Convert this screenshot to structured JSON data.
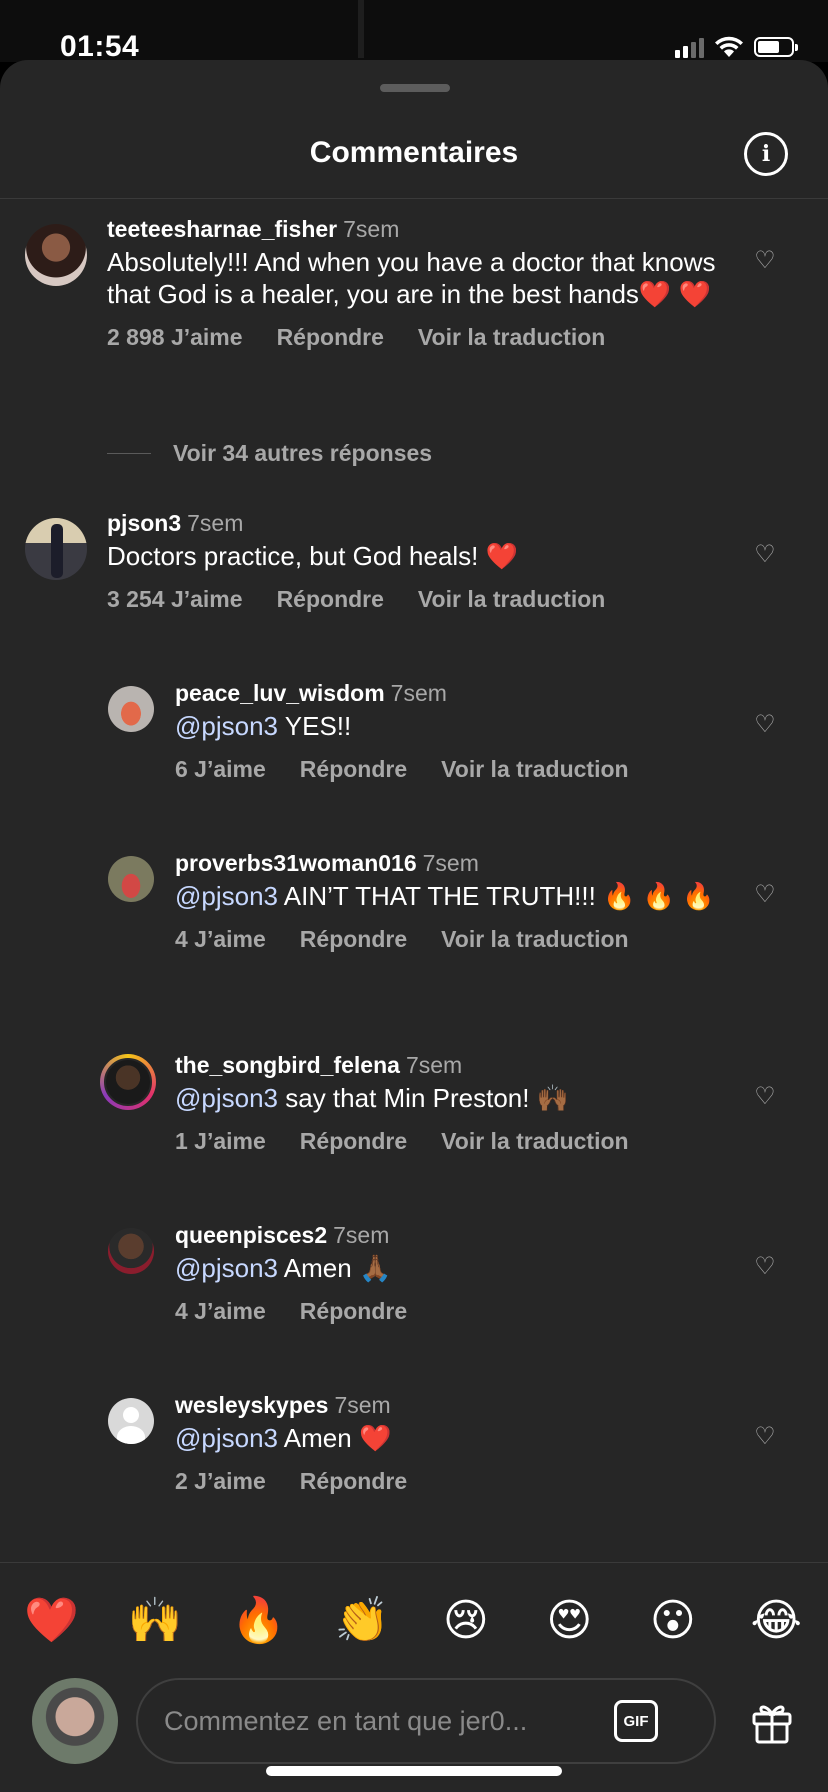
{
  "status_bar": {
    "time": "01:54",
    "battery_level": 0.65
  },
  "header": {
    "title": "Commentaires"
  },
  "comments": [
    {
      "username": "teeteesharnae_fisher",
      "time": "7sem",
      "text": "Absolutely!!! And when you have a doctor that knows that God is a healer, you are in the best hands❤️ ❤️",
      "likes": "2 898 J’aime",
      "reply": "Répondre",
      "translate": "Voir la traduction"
    },
    {
      "view_more": "Voir 34 autres réponses"
    },
    {
      "username": "pjson3",
      "time": "7sem",
      "text": "Doctors practice, but God heals! ❤️",
      "likes": "3 254 J’aime",
      "reply": "Répondre",
      "translate": "Voir la traduction"
    },
    {
      "username": "peace_luv_wisdom",
      "time": "7sem",
      "mention": "@pjson3",
      "text": " YES!!",
      "likes": "6 J’aime",
      "reply": "Répondre",
      "translate": "Voir la traduction"
    },
    {
      "username": "proverbs31woman016",
      "time": "7sem",
      "mention": "@pjson3",
      "text": " AIN’T THAT THE TRUTH!!! 🔥 🔥 🔥",
      "likes": "4 J’aime",
      "reply": "Répondre",
      "translate": "Voir la traduction"
    },
    {
      "username": "the_songbird_felena",
      "time": "7sem",
      "mention": "@pjson3",
      "text": " say that Min Preston! 🙌🏾",
      "likes": "1 J’aime",
      "reply": "Répondre",
      "translate": "Voir la traduction"
    },
    {
      "username": "queenpisces2",
      "time": "7sem",
      "mention": "@pjson3",
      "text": " Amen 🙏🏾",
      "likes": "4 J’aime",
      "reply": "Répondre"
    },
    {
      "username": "wesleyskypes",
      "time": "7sem",
      "mention": "@pjson3",
      "text": " Amen ❤️",
      "likes": "2 J’aime",
      "reply": "Répondre"
    }
  ],
  "emoji_bar": [
    "❤️",
    "🙌",
    "🔥",
    "👏",
    "😢",
    "😍",
    "😮",
    "😂"
  ],
  "composer": {
    "placeholder": "Commentez en tant que jer0...",
    "gif_label": "GIF"
  },
  "icons": {
    "info": "info-icon",
    "heart": "heart-outline-icon",
    "gift": "gift-icon",
    "wifi": "wifi-icon",
    "signal": "cell-signal-icon",
    "battery": "battery-icon"
  }
}
